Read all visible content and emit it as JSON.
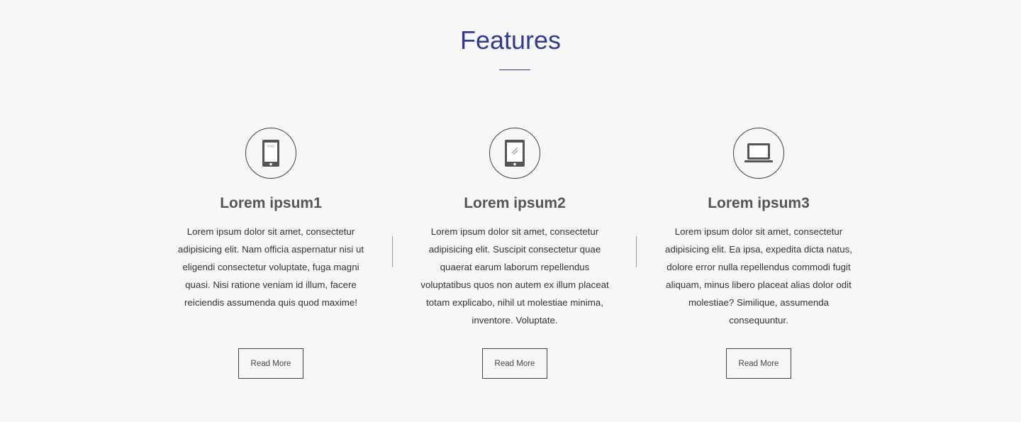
{
  "header": {
    "title": "Features",
    "accent_color": "#2f3b95"
  },
  "features": [
    {
      "icon": "smartphone-icon",
      "icon_text": "9:41",
      "title": "Lorem ipsum1",
      "body": "Lorem ipsum dolor sit amet, consectetur adipisicing elit. Nam officia aspernatur nisi ut eligendi consectetur voluptate, fuga magni quasi. Nisi ratione veniam id illum, facere reiciendis assumenda quis quod maxime!",
      "button": "Read More"
    },
    {
      "icon": "tablet-icon",
      "title": "Lorem ipsum2",
      "body": "Lorem ipsum dolor sit amet, consectetur adipisicing elit. Suscipit consectetur quae quaerat earum laborum repellendus voluptatibus quos non autem ex illum placeat totam explicabo, nihil ut molestiae minima, inventore. Voluptate.",
      "button": "Read More"
    },
    {
      "icon": "laptop-icon",
      "title": "Lorem ipsum3",
      "body": "Lorem ipsum dolor sit amet, consectetur adipisicing elit. Ea ipsa, expedita dicta natus, dolore error nulla repellendus commodi fugit aliquam, minus libero placeat alias dolor odit molestiae? Similique, assumenda consequuntur.",
      "button": "Read More"
    }
  ]
}
